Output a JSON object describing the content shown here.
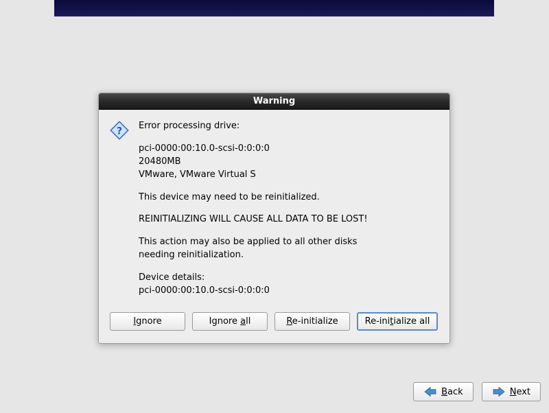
{
  "dialog": {
    "title": "Warning",
    "lines": {
      "l1": "Error processing drive:",
      "l2": "pci-0000:00:10.0-scsi-0:0:0:0",
      "l3": "20480MB",
      "l4": "VMware, VMware Virtual S",
      "l5": "This device may need to be reinitialized.",
      "l6": "REINITIALIZING WILL CAUSE ALL DATA TO BE LOST!",
      "l7": "This action may also be applied to all other disks",
      "l8": "needing reinitialization.",
      "l9": "Device details:",
      "l10": "pci-0000:00:10.0-scsi-0:0:0:0"
    },
    "buttons": {
      "ignore_pre": "I",
      "ignore_post": "gnore",
      "ignore_all_pre": "Ignore ",
      "ignore_all_u": "a",
      "ignore_all_post": "ll",
      "reinit_u": "R",
      "reinit_post": "e-initialize",
      "reinit_all_pre": "Re-ini",
      "reinit_all_u": "t",
      "reinit_all_post": "ialize all"
    }
  },
  "nav": {
    "back_u": "B",
    "back_post": "ack",
    "next_u": "N",
    "next_post": "ext"
  }
}
